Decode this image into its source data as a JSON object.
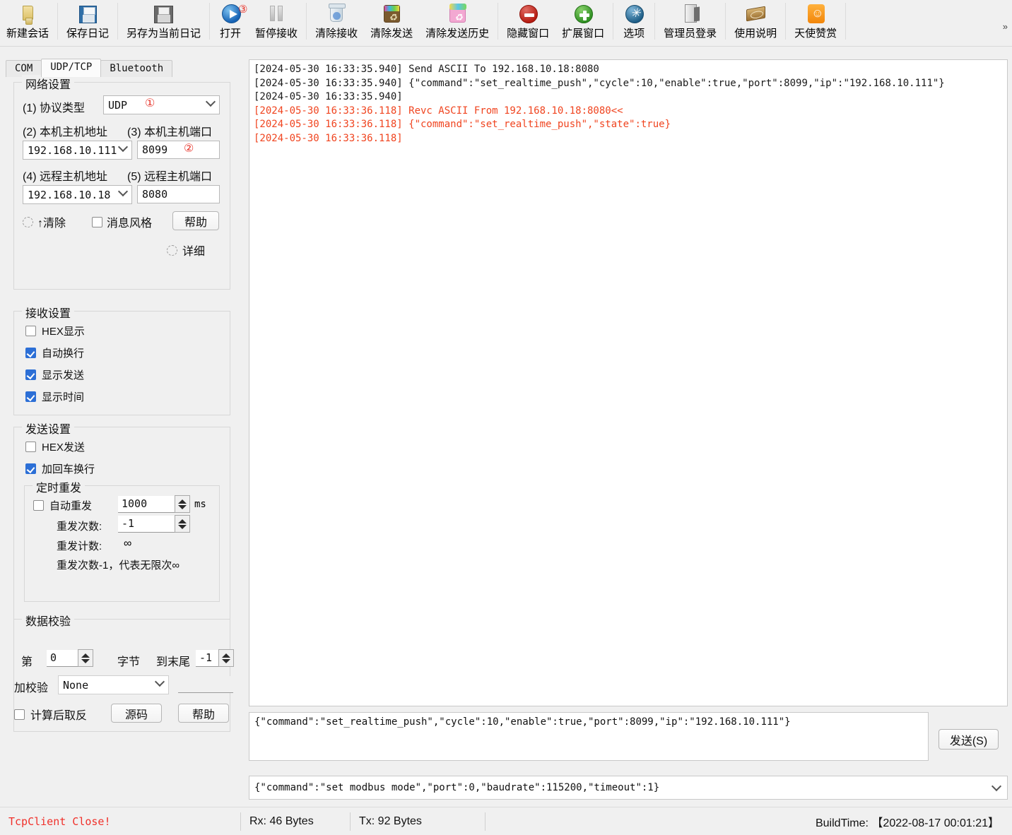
{
  "toolbar": {
    "items": [
      {
        "label": "新建会话",
        "icon": "new-session-folder-icon",
        "badge": ""
      },
      {
        "label": "保存日记",
        "icon": "save-log-floppy-icon",
        "badge": ""
      },
      {
        "label": "另存为当前日记",
        "icon": "save-as-floppy-icon",
        "badge": ""
      },
      {
        "label": "打开",
        "icon": "open-play-icon",
        "badge": "③"
      },
      {
        "label": "暂停接收",
        "icon": "pause-receive-icon",
        "badge": ""
      },
      {
        "label": "清除接收",
        "icon": "clear-receive-trash-icon",
        "badge": ""
      },
      {
        "label": "清除发送",
        "icon": "clear-send-bin-icon",
        "badge": ""
      },
      {
        "label": "清除发送历史",
        "icon": "clear-send-history-bin-icon",
        "badge": ""
      },
      {
        "label": "隐藏窗口",
        "icon": "hide-window-minus-icon",
        "badge": ""
      },
      {
        "label": "扩展窗口",
        "icon": "expand-window-plus-icon",
        "badge": ""
      },
      {
        "label": "选项",
        "icon": "options-gear-icon",
        "badge": ""
      },
      {
        "label": "管理员登录",
        "icon": "admin-login-door-icon",
        "badge": ""
      },
      {
        "label": "使用说明",
        "icon": "help-book-icon",
        "badge": ""
      },
      {
        "label": "天使赞赏",
        "icon": "donate-angel-icon",
        "badge": ""
      }
    ],
    "overflow": "»"
  },
  "tabs": [
    {
      "label": "COM",
      "active": false
    },
    {
      "label": "UDP/TCP",
      "active": true
    },
    {
      "label": "Bluetooth",
      "active": false
    }
  ],
  "network": {
    "title": "网络设置",
    "protocol_label": "(1) 协议类型",
    "protocol_value": "UDP",
    "protocol_badge": "①",
    "local_addr_label": "(2) 本机主机地址",
    "local_port_label": "(3) 本机主机端口",
    "local_addr_value": "192.168.10.111",
    "local_port_value": "8099",
    "local_port_badge": "②",
    "remote_addr_label": "(4) 远程主机地址",
    "remote_port_label": "(5) 远程主机端口",
    "remote_addr_value": "192.168.10.18",
    "remote_port_value": "8080",
    "clear_label": "↑清除",
    "msg_style_label": "消息风格",
    "help_label": "帮助",
    "detail_label": "详细"
  },
  "receive": {
    "title": "接收设置",
    "options": [
      {
        "label": "HEX显示",
        "checked": false
      },
      {
        "label": "自动换行",
        "checked": true
      },
      {
        "label": "显示发送",
        "checked": true
      },
      {
        "label": "显示时间",
        "checked": true
      }
    ]
  },
  "send": {
    "title": "发送设置",
    "options": [
      {
        "label": "HEX发送",
        "checked": false
      },
      {
        "label": "加回车换行",
        "checked": true
      }
    ],
    "resend": {
      "title": "定时重发",
      "auto_label": "自动重发",
      "auto_checked": false,
      "interval_value": "1000",
      "unit": "ms",
      "count_label": "重发次数:",
      "count_value": "-1",
      "counter_label": "重发计数:",
      "counter_value": "∞",
      "note": "重发次数-1，代表无限次∞"
    }
  },
  "checksum": {
    "title": "数据校验",
    "from_label": "第",
    "from_value": "0",
    "byte_label": "字节",
    "to_label": "到末尾",
    "to_value": "-1",
    "add_label": "加校验",
    "algo_value": "None",
    "result_value": "",
    "invert_label": "计算后取反",
    "invert_checked": false,
    "source_label": "源码",
    "help_label": "帮助"
  },
  "log": {
    "lines": [
      {
        "text": "[2024-05-30 16:33:35.940] Send ASCII To 192.168.10.18:8080",
        "type": "tx"
      },
      {
        "text": "[2024-05-30 16:33:35.940] {\"command\":\"set_realtime_push\",\"cycle\":10,\"enable\":true,\"port\":8099,\"ip\":\"192.168.10.111\"}",
        "type": "tx"
      },
      {
        "text": "[2024-05-30 16:33:35.940]",
        "type": "tx"
      },
      {
        "text": "[2024-05-30 16:33:36.118] Revc ASCII From 192.168.10.18:8080<<",
        "type": "rx"
      },
      {
        "text": "[2024-05-30 16:33:36.118] {\"command\":\"set_realtime_push\",\"state\":true}",
        "type": "rx"
      },
      {
        "text": "[2024-05-30 16:33:36.118]",
        "type": "rx"
      }
    ]
  },
  "sendarea": {
    "value": "{\"command\":\"set_realtime_push\",\"cycle\":10,\"enable\":true,\"port\":8099,\"ip\":\"192.168.10.111\"}",
    "button_label": "发送(S)"
  },
  "history": {
    "value": "{\"command\":\"set modbus mode\",\"port\":0,\"baudrate\":115200,\"timeout\":1}"
  },
  "statusbar": {
    "connection": "TcpClient Close!",
    "rx": "Rx: 46 Bytes",
    "tx": "Tx: 92 Bytes",
    "buildtime": "BuildTime: 【2022-08-17 00:01:21】"
  },
  "colors": {
    "rx_red": "#f0441f",
    "status_red": "#f0302a",
    "accent_blue": "#2c6fd6",
    "bg": "#f0f0f0"
  }
}
